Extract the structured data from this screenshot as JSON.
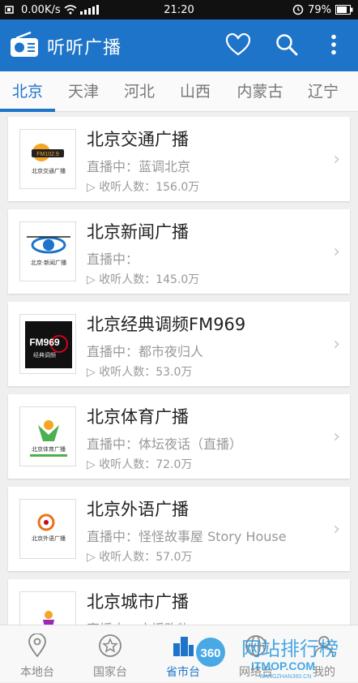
{
  "status_bar": {
    "speed": "0.00K/s",
    "time": "21:20",
    "battery": "79%"
  },
  "app": {
    "title": "听听广播",
    "logo_icon": "radio-icon",
    "accent": "#1e74c9"
  },
  "tabs": [
    {
      "label": "北京",
      "active": true
    },
    {
      "label": "天津"
    },
    {
      "label": "河北"
    },
    {
      "label": "山西"
    },
    {
      "label": "内蒙古"
    },
    {
      "label": "辽宁"
    }
  ],
  "stations": [
    {
      "name": "北京交通广播",
      "live": "直播中：蓝调北京",
      "listeners": "▷ 收听人数：156.0万",
      "logo_text": "FM102.9",
      "logo_sub": "北京交通广播"
    },
    {
      "name": "北京新闻广播",
      "live": "直播中：",
      "listeners": "▷ 收听人数：145.0万",
      "logo_text": "",
      "logo_sub": "北京·新闻广播"
    },
    {
      "name": "北京经典调频FM969",
      "live": "直播中：都市夜归人",
      "listeners": "▷ 收听人数：53.0万",
      "logo_text": "FM969",
      "logo_sub": "经典调频"
    },
    {
      "name": "北京体育广播",
      "live": "直播中：体坛夜话（直播）",
      "listeners": "▷ 收听人数：72.0万",
      "logo_text": "",
      "logo_sub": "北京体育广播"
    },
    {
      "name": "北京外语广播",
      "live": "直播中：怪怪故事屋 Story House",
      "listeners": "▷ 收听人数：57.0万",
      "logo_text": "",
      "logo_sub": "北京外语广播"
    },
    {
      "name": "北京城市广播",
      "live": "直播中：广播购物",
      "listeners": "",
      "logo_text": "",
      "logo_sub": ""
    }
  ],
  "bottom_nav": [
    {
      "label": "本地台",
      "icon": "location-pin-icon"
    },
    {
      "label": "国家台",
      "icon": "star-circle-icon"
    },
    {
      "label": "省市台",
      "icon": "city-buildings-icon",
      "active": true
    },
    {
      "label": "网络台",
      "icon": "globe-icon"
    },
    {
      "label": "我的",
      "icon": "user-icon"
    }
  ],
  "watermark": {
    "badge": "360",
    "text": "网站排行榜",
    "sub": "ITMOP.COM",
    "sub2": "WANGZHAN360.CN"
  }
}
